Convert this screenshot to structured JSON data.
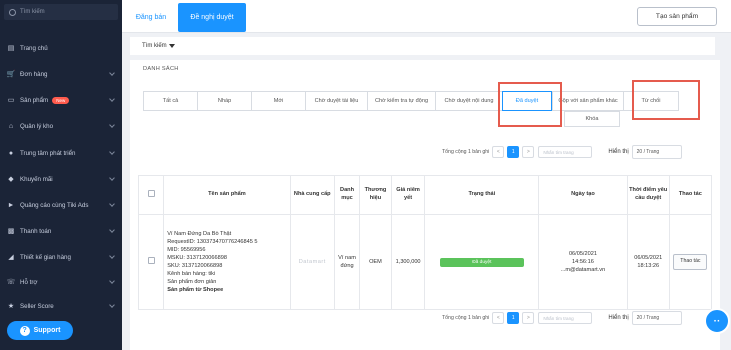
{
  "sidebar": {
    "search_placeholder": "Tìm kiếm",
    "items": [
      {
        "label": "Trang chủ",
        "icon": "chart-icon"
      },
      {
        "label": "Đơn hàng",
        "icon": "cart-icon"
      },
      {
        "label": "Sản phẩm",
        "icon": "box-icon",
        "badge": "New"
      },
      {
        "label": "Quản lý kho",
        "icon": "warehouse-icon"
      },
      {
        "label": "Trung tâm phát triển",
        "icon": "rocket-icon"
      },
      {
        "label": "Khuyến mãi",
        "icon": "tag-icon"
      },
      {
        "label": "Quảng cáo cùng Tiki Ads",
        "icon": "megaphone-icon"
      },
      {
        "label": "Thanh toán",
        "icon": "payment-icon"
      },
      {
        "label": "Thiết kế gian hàng",
        "icon": "design-icon"
      },
      {
        "label": "Hỗ trợ",
        "icon": "support-icon"
      },
      {
        "label": "Seller Score",
        "icon": "star-icon"
      }
    ],
    "support_button": "Support"
  },
  "top_tabs": {
    "t1": "Đăng bán",
    "t2": "Đề nghị duyệt"
  },
  "create_button": "Tạo sản phẩm",
  "filter_label": "Tìm kiếm",
  "panel_title": "DANH SÁCH",
  "status_tabs": [
    "Tất cả",
    "Nháp",
    "Mới",
    "Chờ duyệt tài liệu",
    "Chờ kiểm tra tự động",
    "Chờ duyệt nội dung",
    "Đã duyệt",
    "Gộp với sản phẩm khác",
    "Từ chối"
  ],
  "status_tab_sub": "Khóa",
  "pager": {
    "total": "Tổng cộng 1 bản ghi",
    "prev": "<",
    "page": "1",
    "next": ">",
    "input_placeholder": "Nhấn tìm trang",
    "show_label": "Hiển thị",
    "per_page": "20 / Trang"
  },
  "table": {
    "headers": [
      "",
      "Tên sản phẩm",
      "Nhà cung cấp",
      "Danh mục",
      "Thương hiệu",
      "Giá niêm yết",
      "Trạng thái",
      "Ngày tạo",
      "Thời điểm yêu cầu duyệt",
      "Thao tác"
    ],
    "row": {
      "product_lines": [
        "Ví Nam Đứng Da Bò Thật",
        "RequestID: 130373470776246845 5",
        "MID: 95569956",
        "MSKU: 3137120066898",
        "SKU: 3137120066898",
        "Kênh bán hàng: tiki",
        "Sản phẩm đơn giản"
      ],
      "product_source": "Sản phẩm từ Shopee",
      "supplier": "Datamart",
      "category": "Ví nam đứng",
      "brand": "OEM",
      "price": "1,300,000",
      "status": "Đã duyệt",
      "created_date": "06/05/2021",
      "created_time": "14:56:16",
      "created_by": "...m@datamart.vn",
      "requested_date": "06/05/2021",
      "requested_time": "18:13:26",
      "action": "Thao tác"
    }
  },
  "colors": {
    "accent": "#1a94ff",
    "sidebar": "#1b2437",
    "highlight": "#e55b4d",
    "success": "#5bc35b"
  }
}
